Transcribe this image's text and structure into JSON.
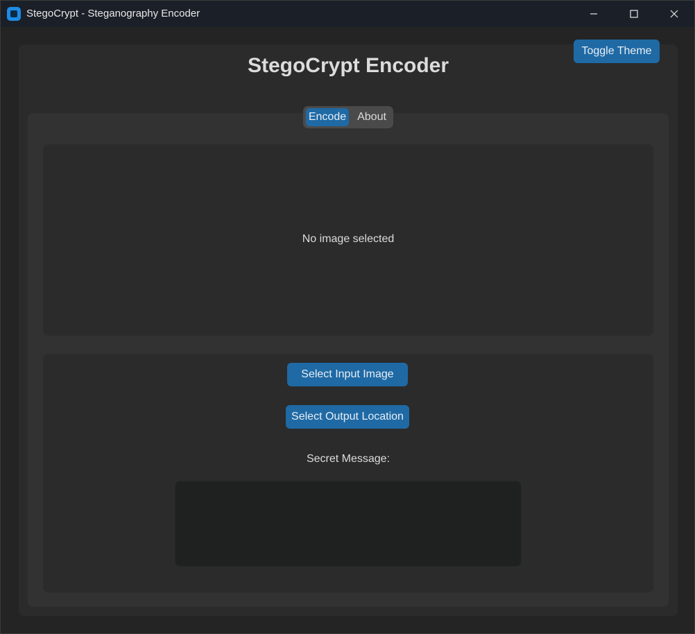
{
  "window": {
    "title": "StegoCrypt - Steganography Encoder",
    "app_icon": "app-icon",
    "controls": [
      "minimize-icon",
      "maximize-icon",
      "close-icon"
    ]
  },
  "header": {
    "title": "StegoCrypt Encoder",
    "toggle_theme_label": "Toggle Theme"
  },
  "tabs": [
    {
      "label": "Encode",
      "selected": true
    },
    {
      "label": "About",
      "selected": false
    }
  ],
  "preview": {
    "status_text": "No image selected"
  },
  "controls": {
    "select_input_label": "Select Input Image",
    "select_output_label": "Select Output Location",
    "secret_message_label": "Secret Message:",
    "secret_message_value": ""
  },
  "colors": {
    "accent": "#1f6aa5",
    "background": "#242424",
    "panel": "#2b2b2b",
    "tabview": "#323232",
    "textbox": "#1f2020",
    "text": "#dcdcdc"
  }
}
